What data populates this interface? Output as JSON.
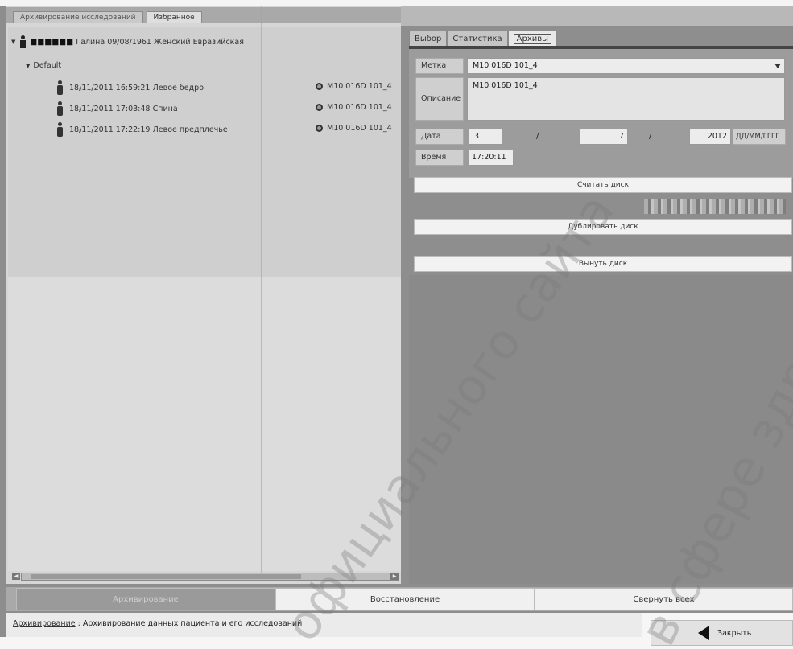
{
  "left_tabs": [
    "Архивирование исследований",
    "Избранное"
  ],
  "tree": {
    "patient": {
      "name": "Галина",
      "details": "09/08/1961 Женский Евразийская"
    },
    "folder": "Default",
    "studies": [
      {
        "datetime": "18/11/2011 16:59:21",
        "desc": "Левое бедро",
        "disc": "M10 016D 101_4"
      },
      {
        "datetime": "18/11/2011 17:03:48",
        "desc": "Спина",
        "disc": "M10 016D 101_4"
      },
      {
        "datetime": "18/11/2011 17:22:19",
        "desc": "Левое предплечье",
        "disc": "M10 016D 101_4"
      }
    ]
  },
  "right_tabs": [
    "Выбор",
    "Статистика",
    "Архивы"
  ],
  "active_right_tab": "Архивы",
  "form": {
    "label_label": "Метка",
    "label_value": "M10 016D 101_4",
    "desc_label": "Описание",
    "desc_value": "M10 016D 101_4",
    "date_label": "Дата",
    "date_day": "3",
    "date_month": "7",
    "date_year": "2012",
    "date_sep": "/",
    "date_format": "ДД/ММ/ГГГГ",
    "time_label": "Время",
    "time_value": "17:20:11"
  },
  "disc_buttons": {
    "read": "Считать диск",
    "duplicate": "Дублировать диск",
    "eject": "Вынуть диск"
  },
  "bottom_buttons": {
    "archive": "Архивирование",
    "restore": "Восстановление",
    "collapse": "Свернуть всех"
  },
  "status": {
    "link": "Архивирование",
    "sep": " : ",
    "text": "Архивирование данных пациента и его исследований"
  },
  "close_label": "Закрыть",
  "watermark": [
    "официального сайта",
    "в сфере здраво"
  ]
}
